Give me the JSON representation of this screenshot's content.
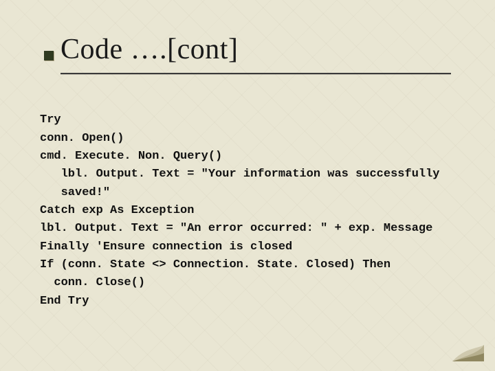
{
  "slide": {
    "title": "Code ….[cont]"
  },
  "code": {
    "lines": [
      "Try",
      "conn. Open()",
      "cmd. Execute. Non. Query()",
      "   lbl. Output. Text = \"Your information was successfully",
      "   saved!\"",
      "Catch exp As Exception",
      "lbl. Output. Text = \"An error occurred: \" + exp. Message",
      "Finally 'Ensure connection is closed",
      "If (conn. State <> Connection. State. Closed) Then",
      "  conn. Close()",
      "End Try"
    ]
  },
  "colors": {
    "background": "#e9e6d3",
    "bullet": "#2f3a20",
    "text": "#111111",
    "rule": "#3a3a3a"
  }
}
